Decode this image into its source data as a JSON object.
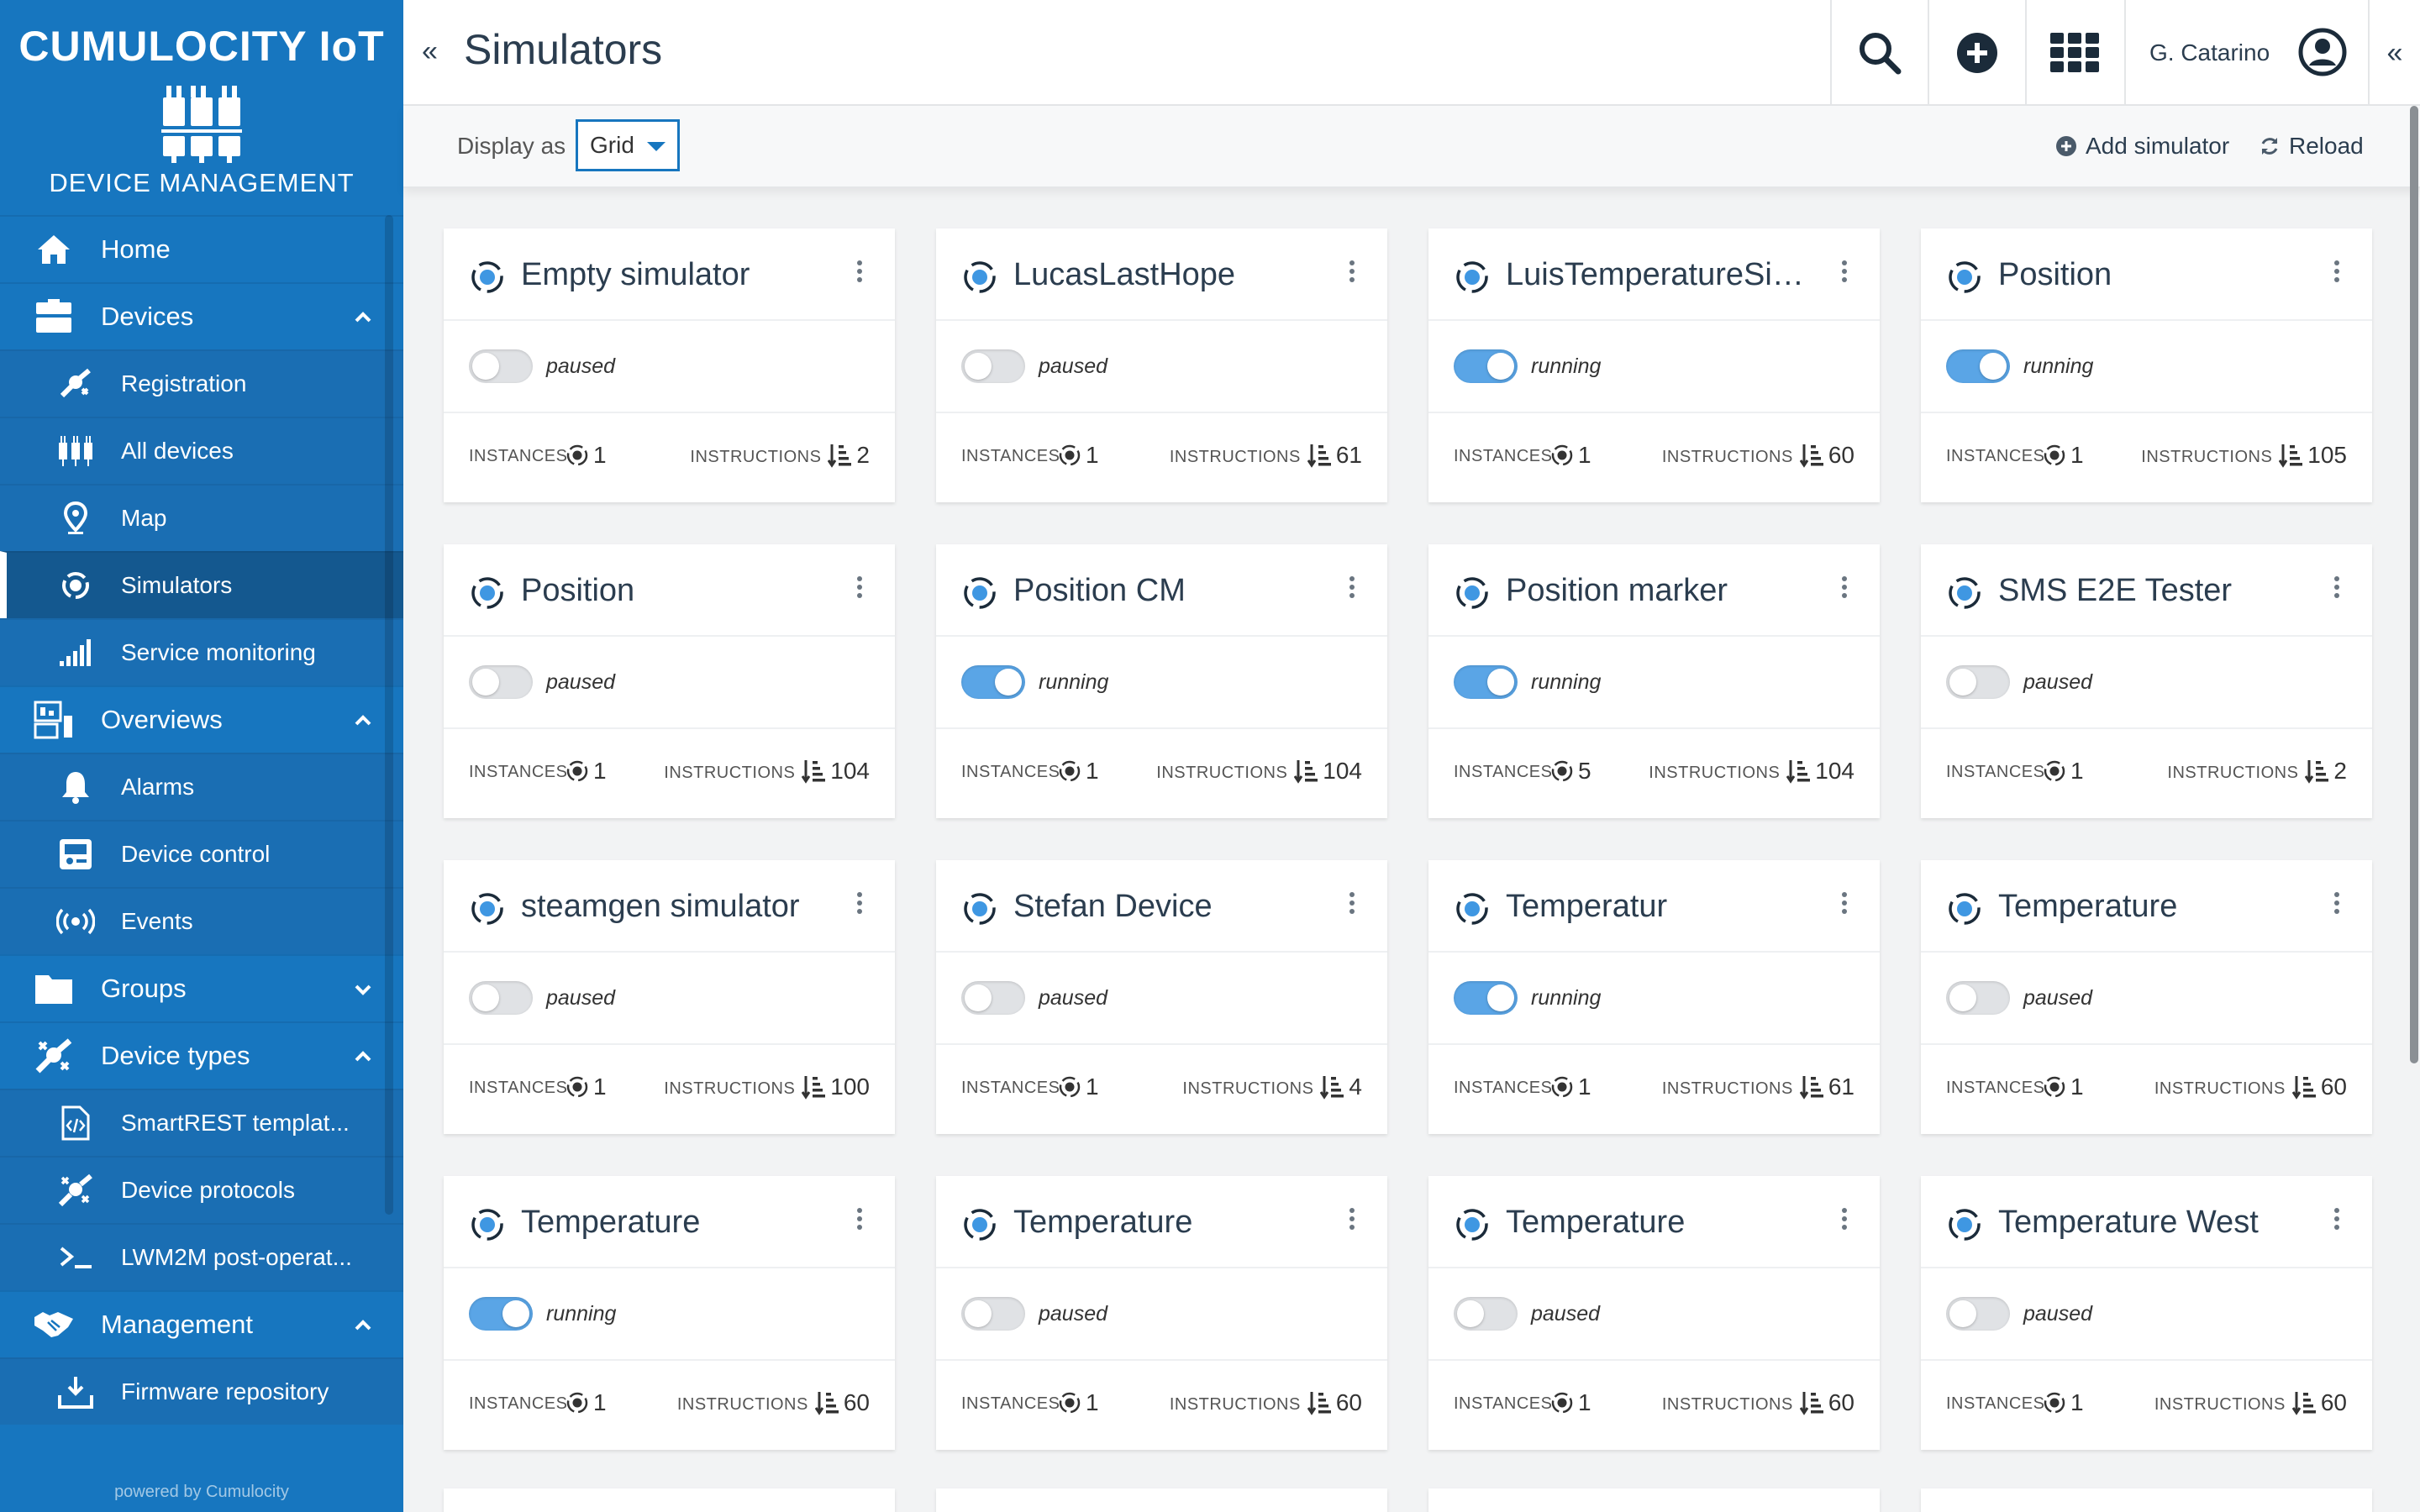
{
  "brand": {
    "name": "CUMULOCITY IoT",
    "app": "DEVICE MANAGEMENT",
    "powered": "powered by Cumulocity"
  },
  "nav": {
    "home": "Home",
    "devices": "Devices",
    "registration": "Registration",
    "all_devices": "All devices",
    "map": "Map",
    "simulators": "Simulators",
    "service_monitoring": "Service monitoring",
    "overviews": "Overviews",
    "alarms": "Alarms",
    "device_control": "Device control",
    "events": "Events",
    "groups": "Groups",
    "device_types": "Device types",
    "smartrest": "SmartREST templat...",
    "device_protocols": "Device protocols",
    "lwm2m": "LWM2M post-operat...",
    "management": "Management",
    "firmware": "Firmware repository"
  },
  "header": {
    "title": "Simulators",
    "user": "G. Catarino"
  },
  "actionbar": {
    "display_label": "Display as",
    "display_value": "Grid",
    "add_simulator": "Add simulator",
    "reload": "Reload"
  },
  "labels": {
    "instances": "INSTANCES",
    "instructions": "INSTRUCTIONS"
  },
  "colors": {
    "brand_blue": "#1776bf",
    "toggle_on": "#5aa5e6",
    "text_dark": "#2b3d4f"
  },
  "simulators": [
    {
      "name": "Empty simulator",
      "status": "paused",
      "running": false,
      "instances": "1",
      "instructions": "2"
    },
    {
      "name": "LucasLastHope",
      "status": "paused",
      "running": false,
      "instances": "1",
      "instructions": "61"
    },
    {
      "name": "LuisTemperatureSim...",
      "status": "running",
      "running": true,
      "instances": "1",
      "instructions": "60"
    },
    {
      "name": "Position",
      "status": "running",
      "running": true,
      "instances": "1",
      "instructions": "105"
    },
    {
      "name": "Position",
      "status": "paused",
      "running": false,
      "instances": "1",
      "instructions": "104"
    },
    {
      "name": "Position CM",
      "status": "running",
      "running": true,
      "instances": "1",
      "instructions": "104"
    },
    {
      "name": "Position marker",
      "status": "running",
      "running": true,
      "instances": "5",
      "instructions": "104"
    },
    {
      "name": "SMS E2E Tester",
      "status": "paused",
      "running": false,
      "instances": "1",
      "instructions": "2"
    },
    {
      "name": "steamgen simulator",
      "status": "paused",
      "running": false,
      "instances": "1",
      "instructions": "100"
    },
    {
      "name": "Stefan Device",
      "status": "paused",
      "running": false,
      "instances": "1",
      "instructions": "4"
    },
    {
      "name": "Temperatur",
      "status": "running",
      "running": true,
      "instances": "1",
      "instructions": "61"
    },
    {
      "name": "Temperature",
      "status": "paused",
      "running": false,
      "instances": "1",
      "instructions": "60"
    },
    {
      "name": "Temperature",
      "status": "running",
      "running": true,
      "instances": "1",
      "instructions": "60"
    },
    {
      "name": "Temperature",
      "status": "paused",
      "running": false,
      "instances": "1",
      "instructions": "60"
    },
    {
      "name": "Temperature",
      "status": "paused",
      "running": false,
      "instances": "1",
      "instructions": "60"
    },
    {
      "name": "Temperature West",
      "status": "paused",
      "running": false,
      "instances": "1",
      "instructions": "60"
    }
  ]
}
